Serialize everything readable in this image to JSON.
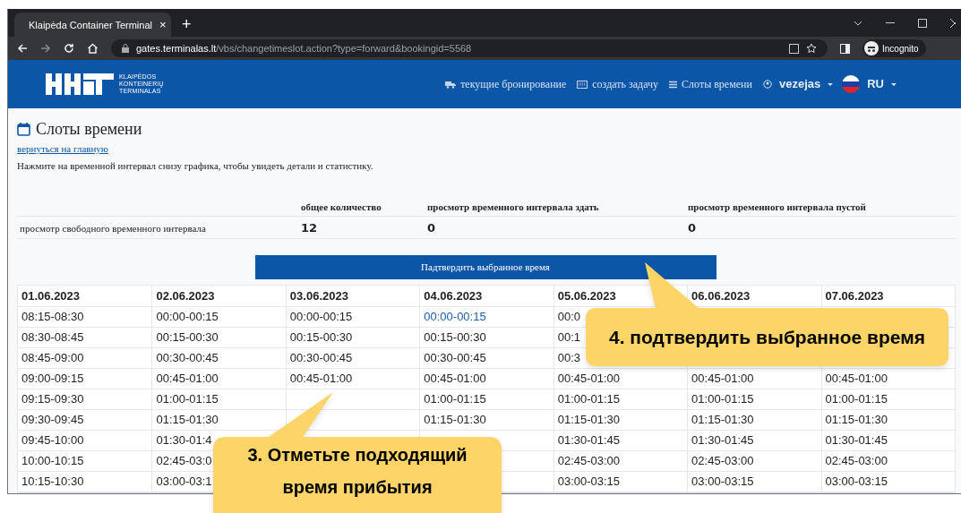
{
  "browser": {
    "tab_title": "Klaipėda Container Terminal",
    "tab_close": "×",
    "new_tab": "+",
    "url_host": "gates.terminalas.lt",
    "url_path": "/vbs/changetimeslot.action?type=forward&bookingid=5568",
    "profile": "Incognito"
  },
  "header": {
    "logo_lines": [
      "KLAIPĖDOS",
      "KONTEINERIŲ",
      "TERMINALAS"
    ],
    "nav": [
      {
        "kind": "truck",
        "label": "текущие бронирование"
      },
      {
        "kind": "keyboard",
        "label": "создать задачу"
      },
      {
        "kind": "list",
        "label": "Слоты времени"
      }
    ],
    "user": "vezejas",
    "language": "RU"
  },
  "page": {
    "title": "Слоты времени",
    "back_link": "вернуться на главную",
    "hint": "Нажмите на временной интервал снизу графика, чтобы увидеть детали и статистику.",
    "stats": {
      "columns": [
        "общее количество",
        "просмотр временного интервала здать",
        "просмотр временного интервала пустой"
      ],
      "row_label": "просмотр свободного временного интервала",
      "values": [
        "12",
        "0",
        "0"
      ]
    },
    "confirm_button": "Падтвердить выбранное время",
    "slots": {
      "dates": [
        "01.06.2023",
        "02.06.2023",
        "03.06.2023",
        "04.06.2023",
        "05.06.2023",
        "06.06.2023",
        "07.06.2023"
      ],
      "rows": [
        [
          {
            "text": "08:15-08:30",
            "selected": false
          },
          {
            "text": "00:00-00:15",
            "selected": false
          },
          {
            "text": "00:00-00:15",
            "selected": false
          },
          {
            "text": "00:00-00:15",
            "selected": true
          },
          {
            "text": "00:0",
            "selected": false
          },
          null,
          null
        ],
        [
          {
            "text": "08:30-08:45",
            "selected": false
          },
          {
            "text": "00:15-00:30",
            "selected": false
          },
          {
            "text": "00:15-00:30",
            "selected": false
          },
          {
            "text": "00:15-00:30",
            "selected": false
          },
          {
            "text": "00:1",
            "selected": false
          },
          null,
          null
        ],
        [
          {
            "text": "08:45-09:00",
            "selected": false
          },
          {
            "text": "00:30-00:45",
            "selected": false
          },
          {
            "text": "00:30-00:45",
            "selected": false
          },
          {
            "text": "00:30-00:45",
            "selected": false
          },
          {
            "text": "00:3",
            "selected": false
          },
          null,
          null
        ],
        [
          {
            "text": "09:00-09:15",
            "selected": false
          },
          {
            "text": "00:45-01:00",
            "selected": false
          },
          {
            "text": "00:45-01:00",
            "selected": false
          },
          {
            "text": "00:45-01:00",
            "selected": false
          },
          {
            "text": "00:45-01:00",
            "selected": false
          },
          {
            "text": "00:45-01:00",
            "selected": false
          },
          {
            "text": "00:45-01:00",
            "selected": false
          }
        ],
        [
          {
            "text": "09:15-09:30",
            "selected": false
          },
          {
            "text": "01:00-01:15",
            "selected": false
          },
          null,
          {
            "text": "01:00-01:15",
            "selected": false
          },
          {
            "text": "01:00-01:15",
            "selected": false
          },
          {
            "text": "01:00-01:15",
            "selected": false
          },
          {
            "text": "01:00-01:15",
            "selected": false
          }
        ],
        [
          {
            "text": "09:30-09:45",
            "selected": false
          },
          {
            "text": "01:15-01:30",
            "selected": false
          },
          null,
          {
            "text": "01:15-01:30",
            "selected": false
          },
          {
            "text": "01:15-01:30",
            "selected": false
          },
          {
            "text": "01:15-01:30",
            "selected": false
          },
          {
            "text": "01:15-01:30",
            "selected": false
          }
        ],
        [
          {
            "text": "09:45-10:00",
            "selected": false
          },
          {
            "text": "01:30-01:4",
            "selected": false
          },
          null,
          null,
          {
            "text": "01:30-01:45",
            "selected": false
          },
          {
            "text": "01:30-01:45",
            "selected": false
          },
          {
            "text": "01:30-01:45",
            "selected": false
          }
        ],
        [
          {
            "text": "10:00-10:15",
            "selected": false
          },
          {
            "text": "02:45-03:0",
            "selected": false
          },
          null,
          null,
          {
            "text": "02:45-03:00",
            "selected": false
          },
          {
            "text": "02:45-03:00",
            "selected": false
          },
          {
            "text": "02:45-03:00",
            "selected": false
          }
        ],
        [
          {
            "text": "10:15-10:30",
            "selected": false
          },
          {
            "text": "03:00-03:1",
            "selected": false
          },
          null,
          null,
          {
            "text": "03:00-03:15",
            "selected": false
          },
          {
            "text": "03:00-03:15",
            "selected": false
          },
          {
            "text": "03:00-03:15",
            "selected": false
          }
        ]
      ]
    }
  },
  "callouts": [
    {
      "lines": [
        "3. Отметьте подходящий",
        "время прибытия"
      ]
    },
    {
      "lines": [
        "4. подтвердить выбранное время"
      ]
    }
  ]
}
